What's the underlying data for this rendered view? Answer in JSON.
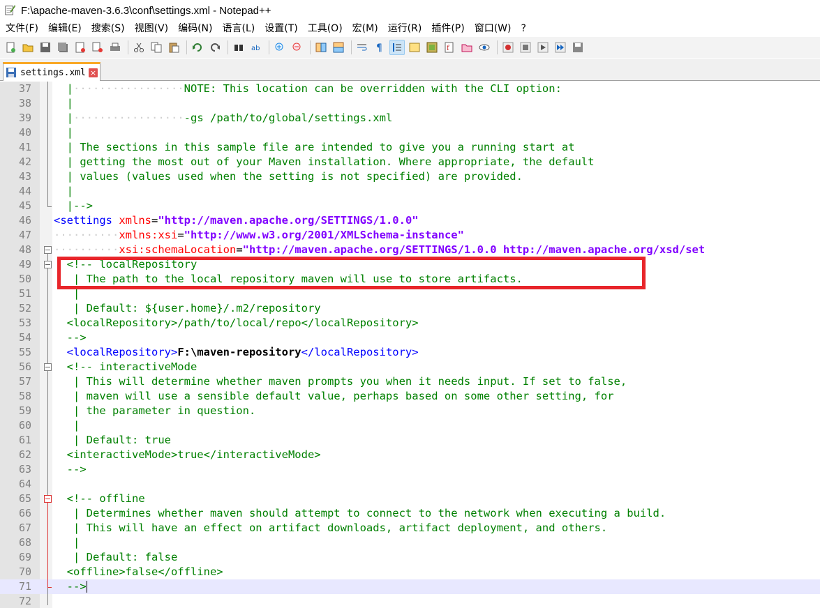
{
  "window": {
    "title": "F:\\apache-maven-3.6.3\\conf\\settings.xml - Notepad++"
  },
  "menu": [
    {
      "id": "file",
      "label": "文件(F)"
    },
    {
      "id": "edit",
      "label": "编辑(E)"
    },
    {
      "id": "search",
      "label": "搜索(S)"
    },
    {
      "id": "view",
      "label": "视图(V)"
    },
    {
      "id": "encoding",
      "label": "编码(N)"
    },
    {
      "id": "language",
      "label": "语言(L)"
    },
    {
      "id": "settings",
      "label": "设置(T)"
    },
    {
      "id": "tools",
      "label": "工具(O)"
    },
    {
      "id": "macro",
      "label": "宏(M)"
    },
    {
      "id": "run",
      "label": "运行(R)"
    },
    {
      "id": "plugins",
      "label": "插件(P)"
    },
    {
      "id": "window",
      "label": "窗口(W)"
    },
    {
      "id": "help",
      "label": "?"
    }
  ],
  "toolbar": {
    "icons": [
      "new-file-icon",
      "open-file-icon",
      "save-icon",
      "save-all-icon",
      "close-icon",
      "close-all-icon",
      "print-icon",
      "cut-icon",
      "copy-icon",
      "paste-icon",
      "undo-icon",
      "redo-icon",
      "find-icon",
      "replace-icon",
      "zoom-in-icon",
      "zoom-out-icon",
      "sync-vertical-icon",
      "sync-horizontal-icon",
      "word-wrap-icon",
      "show-all-chars-icon",
      "indent-guide-icon",
      "user-defined-lang-icon",
      "doc-map-icon",
      "function-list-icon",
      "folder-workspace-icon",
      "monitoring-icon",
      "record-macro-icon",
      "stop-record-icon",
      "play-macro-icon",
      "run-macro-multiple-icon",
      "save-macro-icon"
    ]
  },
  "tab": {
    "label": "settings.xml"
  },
  "colors": {
    "comment": "#008000",
    "tag": "#0000ff",
    "attribute": "#ff0000",
    "attribute_value": "#8000ff",
    "highlight_border": "#e8252a",
    "current_line": "#e8e8ff"
  },
  "editor": {
    "lines": [
      {
        "n": "37",
        "segs": [
          {
            "c": "c-dot",
            "t": "  "
          },
          {
            "c": "c-com",
            "t": "|"
          },
          {
            "c": "c-dot",
            "t": "·················"
          },
          {
            "c": "c-com",
            "t": "NOTE: This location can be overridden with the CLI option:"
          }
        ]
      },
      {
        "n": "38",
        "segs": [
          {
            "c": "c-dot",
            "t": "  "
          },
          {
            "c": "c-com",
            "t": "|"
          }
        ]
      },
      {
        "n": "39",
        "segs": [
          {
            "c": "c-dot",
            "t": "  "
          },
          {
            "c": "c-com",
            "t": "|"
          },
          {
            "c": "c-dot",
            "t": "·················"
          },
          {
            "c": "c-com",
            "t": "-gs /path/to/global/settings.xml"
          }
        ]
      },
      {
        "n": "40",
        "segs": [
          {
            "c": "c-dot",
            "t": "  "
          },
          {
            "c": "c-com",
            "t": "|"
          }
        ]
      },
      {
        "n": "41",
        "segs": [
          {
            "c": "c-dot",
            "t": "  "
          },
          {
            "c": "c-com",
            "t": "| The sections in this sample file are intended to give you a running start at"
          }
        ]
      },
      {
        "n": "42",
        "segs": [
          {
            "c": "c-dot",
            "t": "  "
          },
          {
            "c": "c-com",
            "t": "| getting the most out of your Maven installation. Where appropriate, the default"
          }
        ]
      },
      {
        "n": "43",
        "segs": [
          {
            "c": "c-dot",
            "t": "  "
          },
          {
            "c": "c-com",
            "t": "| values (values used when the setting is not specified) are provided."
          }
        ]
      },
      {
        "n": "44",
        "segs": [
          {
            "c": "c-dot",
            "t": "  "
          },
          {
            "c": "c-com",
            "t": "|"
          }
        ]
      },
      {
        "n": "45",
        "segs": [
          {
            "c": "c-dot",
            "t": "  "
          },
          {
            "c": "c-com",
            "t": "|-->"
          }
        ]
      },
      {
        "n": "46",
        "segs": [
          {
            "c": "c-tag",
            "t": "<settings "
          },
          {
            "c": "c-attr",
            "t": "xmlns"
          },
          {
            "c": "c-plain",
            "t": "="
          },
          {
            "c": "c-val",
            "t": "\"http://maven.apache.org/SETTINGS/1.0.0\""
          }
        ]
      },
      {
        "n": "47",
        "segs": [
          {
            "c": "c-dot",
            "t": "··········"
          },
          {
            "c": "c-attr",
            "t": "xmlns:xsi"
          },
          {
            "c": "c-plain",
            "t": "="
          },
          {
            "c": "c-val",
            "t": "\"http://www.w3.org/2001/XMLSchema-instance\""
          }
        ]
      },
      {
        "n": "48",
        "segs": [
          {
            "c": "c-dot",
            "t": "··········"
          },
          {
            "c": "c-attr",
            "t": "xsi:schemaLocation"
          },
          {
            "c": "c-plain",
            "t": "="
          },
          {
            "c": "c-val",
            "t": "\"http://maven.apache.org/SETTINGS/1.0.0 http://maven.apache.org/xsd/set"
          }
        ]
      },
      {
        "n": "49",
        "segs": [
          {
            "c": "c-dot",
            "t": "  "
          },
          {
            "c": "c-com",
            "t": "<!-- localRepository"
          }
        ]
      },
      {
        "n": "50",
        "segs": [
          {
            "c": "c-dot",
            "t": "   "
          },
          {
            "c": "c-com",
            "t": "| The path to the local repository maven will use to store artifacts."
          }
        ]
      },
      {
        "n": "51",
        "segs": [
          {
            "c": "c-dot",
            "t": "   "
          },
          {
            "c": "c-com",
            "t": "|"
          }
        ]
      },
      {
        "n": "52",
        "segs": [
          {
            "c": "c-dot",
            "t": "   "
          },
          {
            "c": "c-com",
            "t": "| Default: ${user.home}/.m2/repository"
          }
        ]
      },
      {
        "n": "53",
        "segs": [
          {
            "c": "c-dot",
            "t": "  "
          },
          {
            "c": "c-com",
            "t": "<localRepository>/path/to/local/repo</localRepository>"
          }
        ]
      },
      {
        "n": "54",
        "segs": [
          {
            "c": "c-dot",
            "t": "  "
          },
          {
            "c": "c-com",
            "t": "-->"
          }
        ]
      },
      {
        "n": "55",
        "segs": [
          {
            "c": "c-dot",
            "t": "  "
          },
          {
            "c": "c-tag",
            "t": "<localRepository>"
          },
          {
            "c": "c-txt",
            "t": "F:\\maven-repository"
          },
          {
            "c": "c-tag",
            "t": "</localRepository>"
          }
        ]
      },
      {
        "n": "56",
        "segs": [
          {
            "c": "c-dot",
            "t": "  "
          },
          {
            "c": "c-com",
            "t": "<!-- interactiveMode"
          }
        ]
      },
      {
        "n": "57",
        "segs": [
          {
            "c": "c-dot",
            "t": "   "
          },
          {
            "c": "c-com",
            "t": "| This will determine whether maven prompts you when it needs input. If set to false,"
          }
        ]
      },
      {
        "n": "58",
        "segs": [
          {
            "c": "c-dot",
            "t": "   "
          },
          {
            "c": "c-com",
            "t": "| maven will use a sensible default value, perhaps based on some other setting, for"
          }
        ]
      },
      {
        "n": "59",
        "segs": [
          {
            "c": "c-dot",
            "t": "   "
          },
          {
            "c": "c-com",
            "t": "| the parameter in question."
          }
        ]
      },
      {
        "n": "60",
        "segs": [
          {
            "c": "c-dot",
            "t": "   "
          },
          {
            "c": "c-com",
            "t": "|"
          }
        ]
      },
      {
        "n": "61",
        "segs": [
          {
            "c": "c-dot",
            "t": "   "
          },
          {
            "c": "c-com",
            "t": "| Default: true"
          }
        ]
      },
      {
        "n": "62",
        "segs": [
          {
            "c": "c-dot",
            "t": "  "
          },
          {
            "c": "c-com",
            "t": "<interactiveMode>true</interactiveMode>"
          }
        ]
      },
      {
        "n": "63",
        "segs": [
          {
            "c": "c-dot",
            "t": "  "
          },
          {
            "c": "c-com",
            "t": "-->"
          }
        ]
      },
      {
        "n": "64",
        "segs": []
      },
      {
        "n": "65",
        "segs": [
          {
            "c": "c-dot",
            "t": "  "
          },
          {
            "c": "c-com",
            "t": "<!-- offline"
          }
        ]
      },
      {
        "n": "66",
        "segs": [
          {
            "c": "c-dot",
            "t": "   "
          },
          {
            "c": "c-com",
            "t": "| Determines whether maven should attempt to connect to the network when executing a build."
          }
        ]
      },
      {
        "n": "67",
        "segs": [
          {
            "c": "c-dot",
            "t": "   "
          },
          {
            "c": "c-com",
            "t": "| This will have an effect on artifact downloads, artifact deployment, and others."
          }
        ]
      },
      {
        "n": "68",
        "segs": [
          {
            "c": "c-dot",
            "t": "   "
          },
          {
            "c": "c-com",
            "t": "|"
          }
        ]
      },
      {
        "n": "69",
        "segs": [
          {
            "c": "c-dot",
            "t": "   "
          },
          {
            "c": "c-com",
            "t": "| Default: false"
          }
        ]
      },
      {
        "n": "70",
        "segs": [
          {
            "c": "c-dot",
            "t": "  "
          },
          {
            "c": "c-com",
            "t": "<offline>false</offline>"
          }
        ]
      },
      {
        "n": "71",
        "segs": [
          {
            "c": "c-dot",
            "t": "  "
          },
          {
            "c": "c-com",
            "t": "-->"
          }
        ],
        "current": true
      },
      {
        "n": "72",
        "segs": []
      }
    ]
  }
}
